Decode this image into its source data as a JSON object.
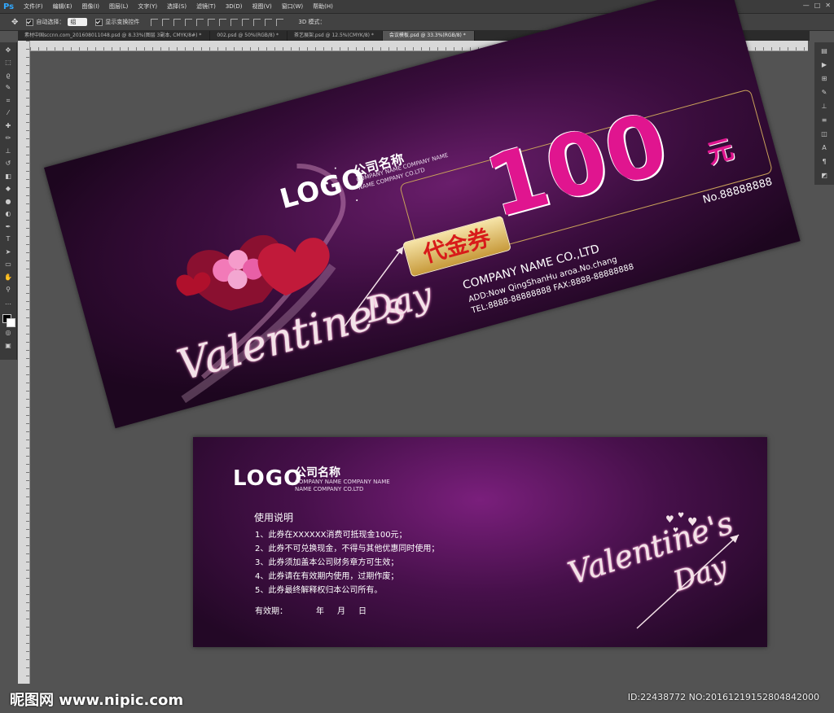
{
  "app": {
    "logo": "Ps",
    "menus": [
      "文件(F)",
      "编辑(E)",
      "图像(I)",
      "图层(L)",
      "文字(Y)",
      "选择(S)",
      "滤镜(T)",
      "3D(D)",
      "视图(V)",
      "窗口(W)",
      "帮助(H)"
    ],
    "window_controls": [
      "—",
      "□",
      "✕"
    ]
  },
  "options_bar": {
    "auto_select_label": "自动选择：",
    "auto_select_value": "组",
    "show_transform_label": "显示变换控件",
    "mode_3d_label": "3D 模式："
  },
  "tabs": [
    {
      "label": "素材中国sccnn.com_20160801104​8.psd @ 8.33%(图层 3副本, CMYK/8#) *",
      "active": false
    },
    {
      "label": "002.psd @ 50%(RGB/8) *",
      "active": false
    },
    {
      "label": "茶艺展架.psd @ 12.5%(CMYK/8) *",
      "active": false
    },
    {
      "label": "会议模板.psd @ 33.3%(RGB/8) *",
      "active": true
    }
  ],
  "ticket_front": {
    "logo": "LOGO",
    "company_cn": "公司名称",
    "company_en_1": "COMPANY NAME COMPANY NAME",
    "company_en_2": "NAME COMPANY CO.LTD",
    "amount": "100",
    "unit": "元",
    "voucher_label": "代金券",
    "serial": "No.88888888",
    "company_name": "COMPANY NAME CO.,LTD",
    "address": "ADD:Now QingShanHu aroa.No.chang",
    "phone": "TEL:8888-88888888   FAX:8888-88888888",
    "script_1": "Valentine's",
    "script_2": "Day"
  },
  "ticket_back": {
    "logo": "LOGO",
    "company_cn": "公司名称",
    "company_en_1": "COMPANY NAME COMPANY NAME",
    "company_en_2": "NAME COMPANY CO.LTD",
    "instructions_title": "使用说明",
    "instructions": [
      "1、此券在XXXXXX消费可抵现金100元；",
      "2、此券不可兑换现金，不得与其他优惠同时使用；",
      "3、此券须加盖本公司财务章方可生效；",
      "4、此券请在有效期内使用，过期作废；",
      "5、此券最终解释权归本公司所有。"
    ],
    "validity_label": "有效期：",
    "validity_year": "年",
    "validity_month": "月",
    "validity_day": "日",
    "script_1": "Valentine's",
    "script_2": "Day"
  },
  "watermark": {
    "site": "昵图网 www.nipic.com",
    "id_text": "ID:22438772 NO:20161219152804842000"
  },
  "colors": {
    "accent_magenta": "#e0158f",
    "gold": "#c9a25a",
    "ps_blue": "#31a8ff"
  }
}
